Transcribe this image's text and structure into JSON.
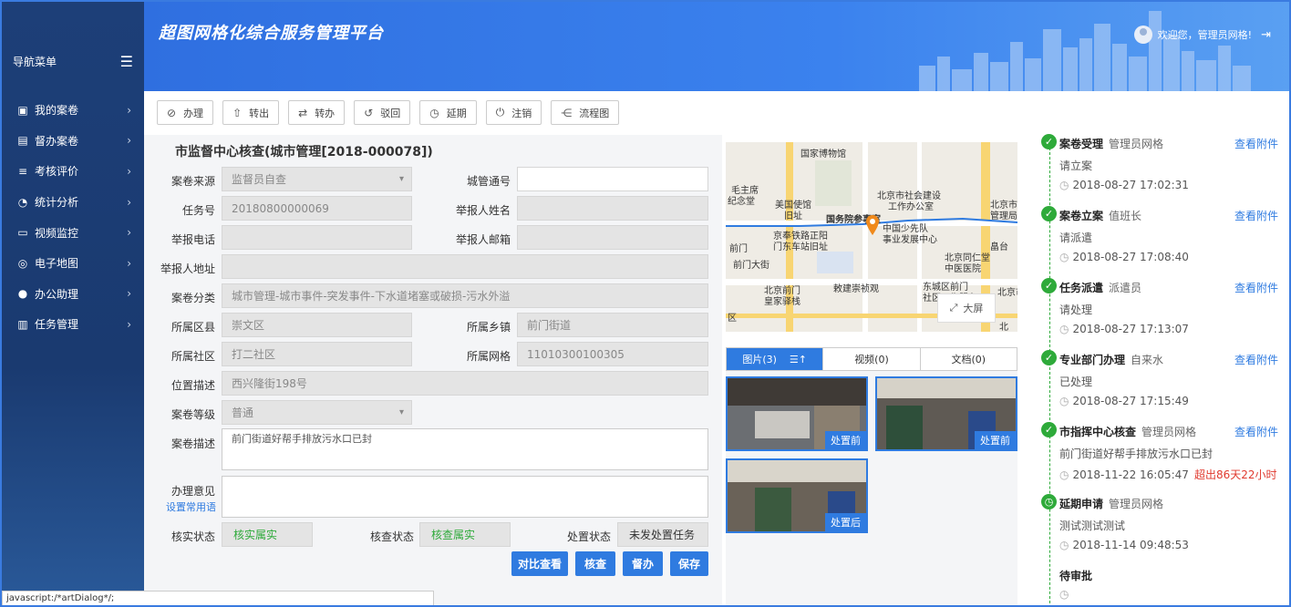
{
  "sidebar": {
    "title": "导航菜单",
    "items": [
      {
        "label": "我的案卷",
        "icon": "monitor-icon"
      },
      {
        "label": "督办案卷",
        "icon": "calendar-icon"
      },
      {
        "label": "考核评价",
        "icon": "edit-list-icon"
      },
      {
        "label": "统计分析",
        "icon": "gauge-icon"
      },
      {
        "label": "视频监控",
        "icon": "screen-icon"
      },
      {
        "label": "电子地图",
        "icon": "globe-icon"
      },
      {
        "label": "办公助理",
        "icon": "person-icon"
      },
      {
        "label": "任务管理",
        "icon": "book-icon"
      }
    ]
  },
  "header": {
    "title": "超图网格化综合服务管理平台",
    "welcome": "欢迎您，管理员网格!"
  },
  "toolbar": [
    {
      "label": "办理",
      "icon": "check-circle-icon"
    },
    {
      "label": "转出",
      "icon": "upload-icon"
    },
    {
      "label": "转办",
      "icon": "swap-icon"
    },
    {
      "label": "驳回",
      "icon": "undo-icon"
    },
    {
      "label": "延期",
      "icon": "clock-icon"
    },
    {
      "label": "注销",
      "icon": "power-icon"
    },
    {
      "label": "流程图",
      "icon": "flow-icon"
    }
  ],
  "form": {
    "title": "市监督中心核查(城市管理[2018-000078])",
    "source_label": "案卷来源",
    "source_value": "监督员自查",
    "citycode_label": "城管通号",
    "citycode_value": "",
    "task_label": "任务号",
    "task_value": "20180800000069",
    "reporter_name_label": "举报人姓名",
    "reporter_name_value": "",
    "reporter_phone_label": "举报电话",
    "reporter_phone_value": "",
    "reporter_email_label": "举报人邮箱",
    "reporter_email_value": "",
    "reporter_addr_label": "举报人地址",
    "reporter_addr_value": "",
    "category_label": "案卷分类",
    "category_value": "城市管理-城市事件-突发事件-下水道堵塞或破损-污水外溢",
    "district_label": "所属区县",
    "district_value": "崇文区",
    "town_label": "所属乡镇",
    "town_value": "前门街道",
    "community_label": "所属社区",
    "community_value": "打二社区",
    "grid_label": "所属网格",
    "grid_value": "11010300100305",
    "location_label": "位置描述",
    "location_value": "西兴隆街198号",
    "level_label": "案卷等级",
    "level_value": "普通",
    "desc_label": "案卷描述",
    "desc_value": "前门街道好帮手排放污水口已封",
    "opinion_label": "办理意见",
    "opinion_link": "设置常用语",
    "verify_label": "核实状态",
    "verify_value": "核实属实",
    "check_label": "核查状态",
    "check_value": "核查属实",
    "handle_label": "处置状态",
    "handle_value": "未发处置任务",
    "buttons": [
      "对比查看",
      "核查",
      "督办",
      "保存"
    ]
  },
  "map": {
    "labels": [
      "国家博物馆",
      "毛主席",
      "纪念堂",
      "美国使馆",
      "旧址",
      "北京市社会建设",
      "工作办公室",
      "北京市",
      "管理局",
      "国务院参事室",
      "中国少先队",
      "事业发展中心",
      "京奉铁路正阳",
      "门东车站旧址",
      "前门",
      "畠台",
      "前门大街",
      "北京同仁堂",
      "中医医院",
      "北京前门",
      "皇家驿栈",
      "敕建崇祯观",
      "东城区前门",
      "社区卫生服务",
      "北京市",
      "区",
      "北"
    ],
    "fullscreen": "大屏"
  },
  "media": {
    "tabs": [
      "图片(3)",
      "视频(0)",
      "文档(0)"
    ],
    "photos": [
      "处置前",
      "处置前",
      "处置后"
    ]
  },
  "timeline": [
    {
      "title": "案卷受理",
      "who": "管理员网格",
      "desc": "请立案",
      "time": "2018-08-27 17:02:31",
      "att": "查看附件",
      "icon": "check-icon"
    },
    {
      "title": "案卷立案",
      "who": "值班长",
      "desc": "请派遣",
      "time": "2018-08-27 17:08:40",
      "att": "查看附件",
      "icon": "check-icon"
    },
    {
      "title": "任务派遣",
      "who": "派遣员",
      "desc": "请处理",
      "time": "2018-08-27 17:13:07",
      "att": "查看附件",
      "icon": "check-icon"
    },
    {
      "title": "专业部门办理",
      "who": "自来水",
      "desc": "已处理",
      "time": "2018-08-27 17:15:49",
      "att": "查看附件",
      "icon": "check-icon"
    },
    {
      "title": "市指挥中心核查",
      "who": "管理员网格",
      "desc": "前门街道好帮手排放污水口已封",
      "time": "2018-11-22 16:05:47",
      "over": "超出86天22小时",
      "att": "查看附件",
      "icon": "check-icon"
    },
    {
      "title": "延期申请",
      "who": "管理员网格",
      "desc": "测试测试测试",
      "time": "2018-11-14 09:48:53",
      "att": "",
      "icon": "clock-icon"
    },
    {
      "title": "待审批",
      "who": "",
      "desc": "",
      "time": "",
      "att": "",
      "icon": ""
    }
  ],
  "statusbar": "javascript:/*artDialog*/;"
}
